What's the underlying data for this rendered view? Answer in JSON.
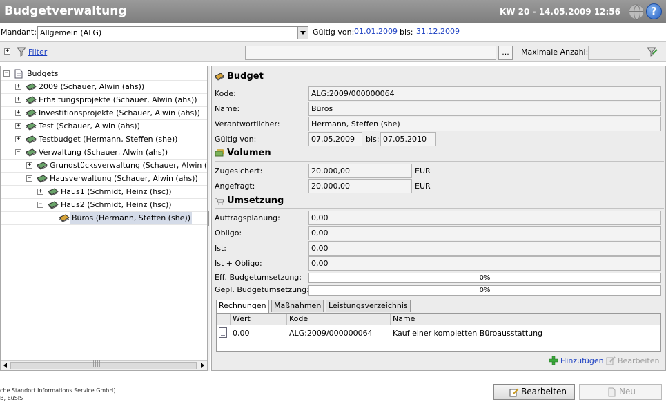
{
  "header": {
    "title": "Budgetverwaltung",
    "week_date": "KW 20 - 14.05.2009 12:56",
    "help_label": "?"
  },
  "mandant": {
    "label": "Mandant:",
    "value": "Allgemein (ALG)",
    "valid_from_label": "Gültig von:",
    "valid_from": "01.01.2009",
    "valid_to_label": "bis:",
    "valid_to": "31.12.2009"
  },
  "filter": {
    "label": "Filter",
    "expander": "+",
    "search_value": "",
    "dots_label": "...",
    "max_label": "Maximale Anzahl:",
    "max_value": ""
  },
  "tree": {
    "nodes": [
      {
        "label": "Budgets",
        "expander": "−"
      },
      {
        "label": "2009 (Schauer, Alwin (ahs))",
        "expander": "+"
      },
      {
        "label": "Erhaltungsprojekte (Schauer, Alwin (ahs))",
        "expander": "+"
      },
      {
        "label": "Investitionsprojekte (Schauer, Alwin (ahs))",
        "expander": "+"
      },
      {
        "label": "Test (Schauer, Alwin (ahs))",
        "expander": "+"
      },
      {
        "label": "Testbudget (Hermann, Steffen  (she))",
        "expander": "+"
      },
      {
        "label": "Verwaltung (Schauer, Alwin (ahs))",
        "expander": "−"
      },
      {
        "label": "Grundstücksverwaltung (Schauer, Alwin (a",
        "expander": "+"
      },
      {
        "label": "Hausverwaltung (Schauer, Alwin (ahs))",
        "expander": "−"
      },
      {
        "label": "Haus1 (Schmidt, Heinz (hsc))",
        "expander": "+"
      },
      {
        "label": "Haus2 (Schmidt, Heinz (hsc))",
        "expander": "−"
      },
      {
        "label": "Büros (Hermann, Steffen  (she))",
        "expander": ""
      }
    ]
  },
  "detail": {
    "budget": {
      "title": "Budget",
      "code_label": "Kode:",
      "code": "ALG:2009/000000064",
      "name_label": "Name:",
      "name": "Büros",
      "responsible_label": "Verantwortlicher:",
      "responsible": "Hermann, Steffen  (she)",
      "valid_from_label": "Gültig von:",
      "valid_from": "07.05.2009",
      "valid_to_label": "bis:",
      "valid_to": "07.05.2010"
    },
    "volume": {
      "title": "Volumen",
      "assured_label": "Zugesichert:",
      "assured": "20.000,00",
      "requested_label": "Angefragt:",
      "requested": "20.000,00",
      "currency": "EUR"
    },
    "implementation": {
      "title": "Umsetzung",
      "order_planning_label": "Auftragsplanung:",
      "order_planning": "0,00",
      "obligo_label": "Obligo:",
      "obligo": "0,00",
      "actual_label": "Ist:",
      "actual": "0,00",
      "actual_obligo_label": "Ist + Obligo:",
      "actual_obligo": "0,00",
      "eff_label": "Eff. Budgetumsetzung:",
      "eff_progress": "0%",
      "planned_label": "Gepl. Budgetumsetzung:",
      "planned_progress": "0%"
    },
    "tabs": [
      "Rechnungen",
      "Maßnahmen",
      "Leistungsverzeichnis"
    ],
    "table": {
      "headers": [
        "Wert",
        "Kode",
        "Name"
      ],
      "rows": [
        {
          "value": "0,00",
          "code": "ALG:2009/000000064",
          "name": "Kauf einer kompletten Büroausstattung"
        }
      ]
    },
    "add_label": "Hinzufügen",
    "edit_label": "Bearbeiten"
  },
  "footer": {
    "line1": "che Standort Informations Service GmbH]",
    "line2": "B, EuSIS",
    "edit_button": "Bearbeiten",
    "new_button": "Neu"
  },
  "colors": {
    "titlebar": "#8a8a8a",
    "link": "#1a3ec2",
    "selected": "#d4dbe8"
  }
}
